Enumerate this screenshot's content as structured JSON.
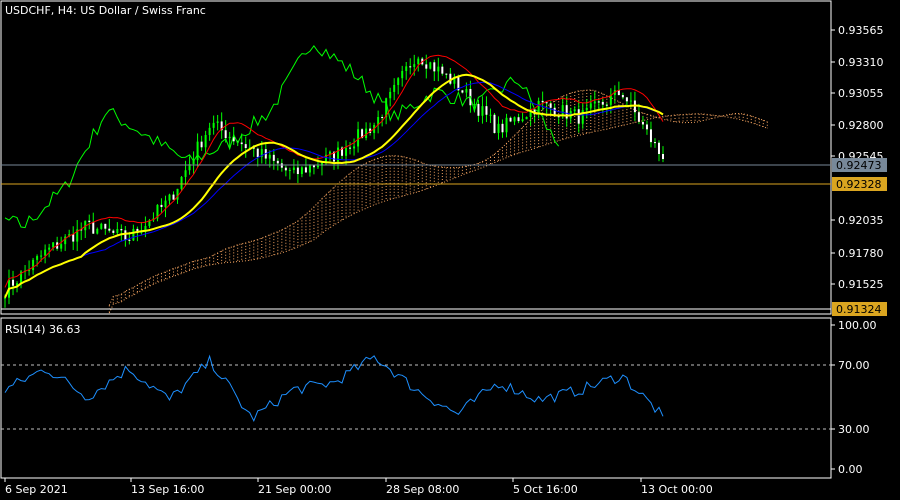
{
  "header": {
    "symbol": "USDCHF",
    "timeframe": "H4",
    "description": "US Dollar / Swiss Franc",
    "title_text": "USDCHF, H4:  US Dollar / Swiss Franc"
  },
  "colors": {
    "background": "#000000",
    "frame": "#ffffff",
    "bullish_candle": "#00ff00",
    "bearish_candle": "#ffffff",
    "ma_fast": "#ffff00",
    "ma_slow": "#0000ff",
    "chikou": "#00ff00",
    "tenkan": "#ff0000",
    "kumo": "#f4a460",
    "rsi_line": "#1e90ff",
    "bid_line": "#778899",
    "ask_line": "#daa520"
  },
  "price_axis": {
    "ticks": [
      "0.93565",
      "0.93310",
      "0.93055",
      "0.92800",
      "0.92545",
      "0.92035",
      "0.91780",
      "0.91525"
    ],
    "bid_label": "0.92473",
    "ask_label": "0.92328",
    "low_label": "0.91324"
  },
  "rsi": {
    "label": "RSI(14) 36.63",
    "period": 14,
    "last_value": 36.63,
    "levels": [
      70,
      30
    ],
    "axis_ticks": [
      "100.00",
      "70.00",
      "30.00",
      "0.00"
    ]
  },
  "time_axis": {
    "labels": [
      "6 Sep 2021",
      "13 Sep 16:00",
      "21 Sep 00:00",
      "28 Sep 08:00",
      "5 Oct 16:00",
      "13 Oct 00:00"
    ]
  },
  "chart_data": [
    {
      "type": "line",
      "title": "USDCHF, H4:  US Dollar / Swiss Franc",
      "series": [
        {
          "name": "USDCHF",
          "x": [
            "6 Sep 2021",
            "8 Sep 2021",
            "10 Sep 2021",
            "13 Sep 16:00",
            "15 Sep 2021",
            "17 Sep 2021",
            "21 Sep 00:00",
            "23 Sep 2021",
            "25 Sep 2021",
            "28 Sep 08:00",
            "30 Sep 2021",
            "2 Oct 2021",
            "5 Oct 16:00",
            "7 Oct 2021",
            "9 Oct 2021",
            "11 Oct 2021",
            "13 Oct 00:00"
          ],
          "y": [
            0.9145,
            0.9175,
            0.9195,
            0.9185,
            0.9215,
            0.9275,
            0.9255,
            0.9235,
            0.925,
            0.9275,
            0.933,
            0.9305,
            0.927,
            0.929,
            0.928,
            0.93,
            0.9247
          ]
        }
      ],
      "ylim": [
        0.9127,
        0.937
      ],
      "bid": 0.92473,
      "ask": 0.92328
    },
    {
      "type": "line",
      "title": "RSI(14) 36.63",
      "series": [
        {
          "name": "RSI(14)",
          "x": [
            "6 Sep 2021",
            "8 Sep 2021",
            "10 Sep 2021",
            "13 Sep 16:00",
            "15 Sep 2021",
            "17 Sep 2021",
            "21 Sep 00:00",
            "23 Sep 2021",
            "25 Sep 2021",
            "28 Sep 08:00",
            "30 Sep 2021",
            "2 Oct 2021",
            "5 Oct 16:00",
            "7 Oct 2021",
            "9 Oct 2021",
            "11 Oct 2021",
            "13 Oct 00:00"
          ],
          "y": [
            55,
            70,
            50,
            70,
            48,
            75,
            35,
            55,
            60,
            78,
            55,
            38,
            60,
            48,
            55,
            65,
            36.63
          ]
        }
      ],
      "ylim": [
        0,
        100
      ]
    }
  ]
}
